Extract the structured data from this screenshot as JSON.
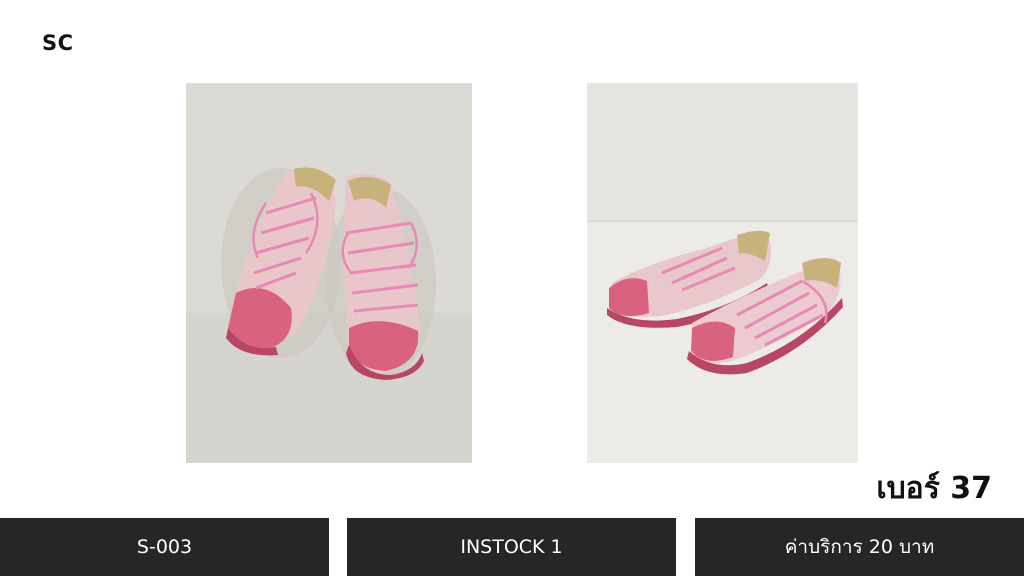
{
  "header": {
    "brand": "SC"
  },
  "product": {
    "size_label": "เบอร์ 37",
    "code": "S-003",
    "stock": "INSTOCK 1",
    "service_fee": "ค่าบริการ 20 บาท"
  },
  "images": [
    {
      "name": "front view photo",
      "subject": "pink low-top canvas sneakers, front view"
    },
    {
      "name": "side view photo",
      "subject": "pink low-top canvas sneakers, side view"
    }
  ],
  "colors": {
    "bar_bg": "#262626",
    "bar_text": "#ffffff",
    "accent_pink": "#d9627f"
  }
}
